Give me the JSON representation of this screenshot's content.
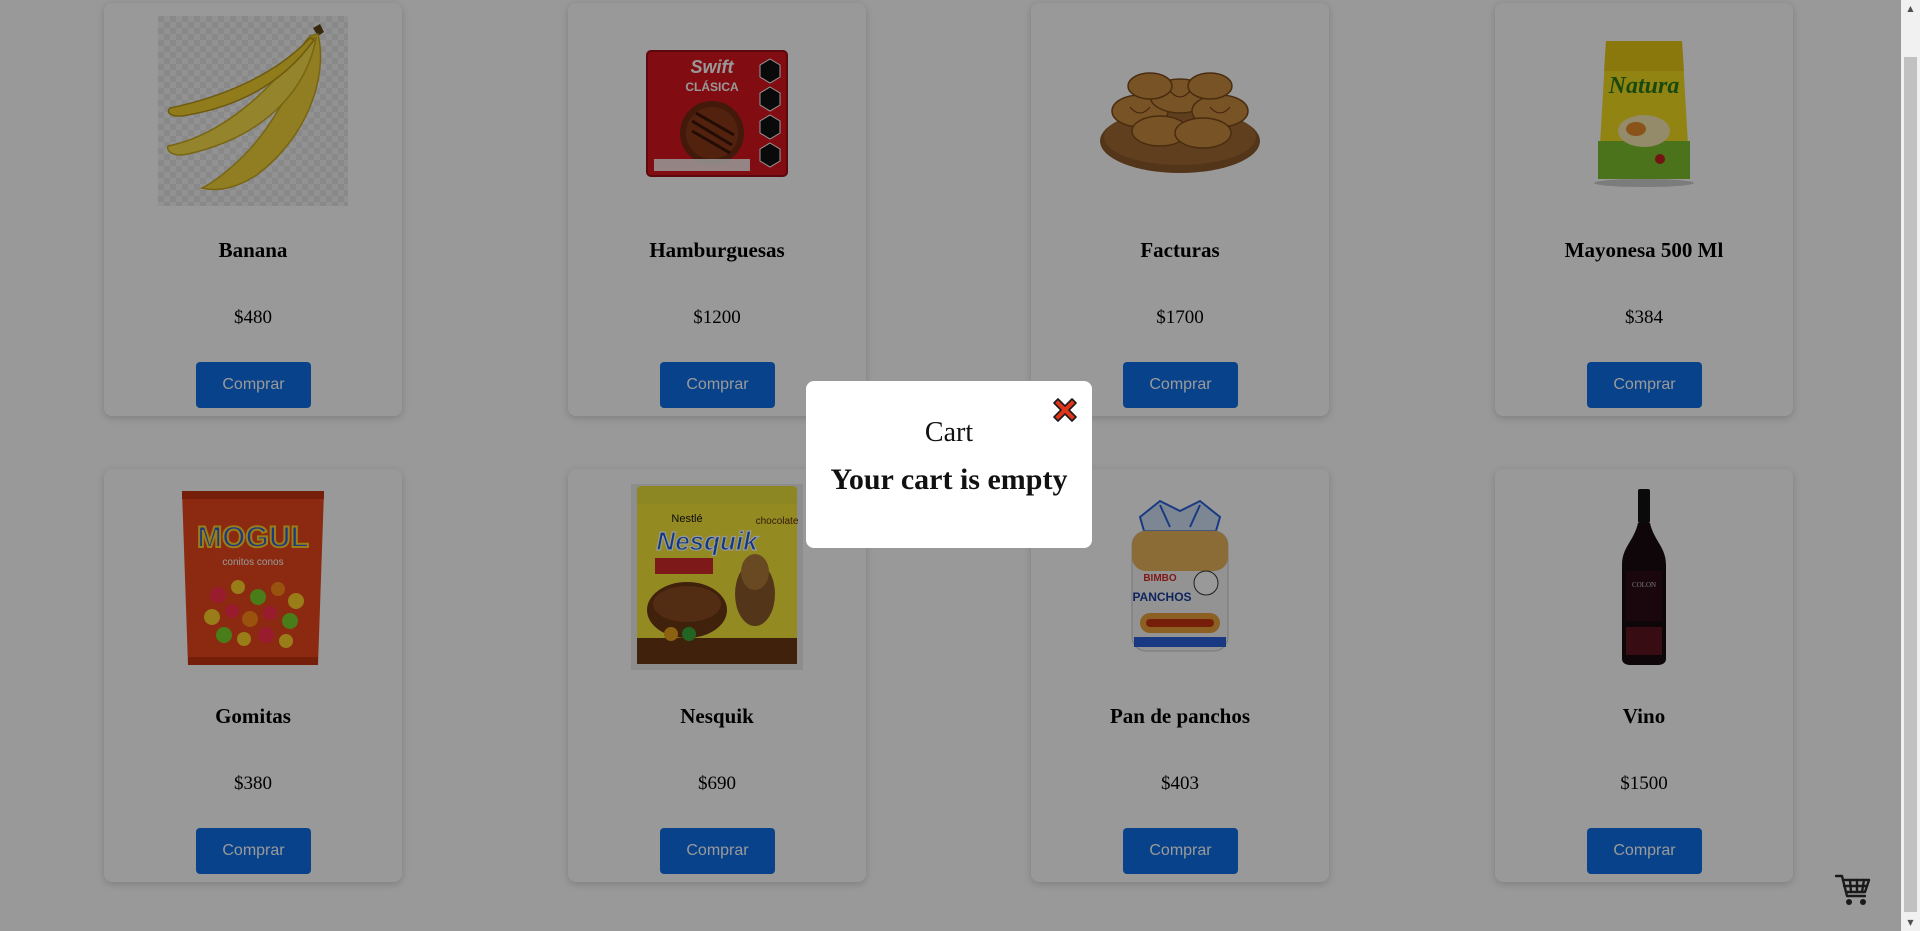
{
  "products": [
    {
      "name": "Banana",
      "price": "$480",
      "button": "Comprar",
      "icon": "banana-image"
    },
    {
      "name": "Hamburguesas",
      "price": "$1200",
      "button": "Comprar",
      "icon": "burger-box-image"
    },
    {
      "name": "Facturas",
      "price": "$1700",
      "button": "Comprar",
      "icon": "croissants-image"
    },
    {
      "name": "Mayonesa 500 Ml",
      "price": "$384",
      "button": "Comprar",
      "icon": "mayonnaise-pouch-image"
    },
    {
      "name": "Gomitas",
      "price": "$380",
      "button": "Comprar",
      "icon": "gummies-bag-image"
    },
    {
      "name": "Nesquik",
      "price": "$690",
      "button": "Comprar",
      "icon": "nesquik-can-image"
    },
    {
      "name": "Pan de panchos",
      "price": "$403",
      "button": "Comprar",
      "icon": "hotdog-buns-image"
    },
    {
      "name": "Vino",
      "price": "$1500",
      "button": "Comprar",
      "icon": "wine-bottle-image"
    }
  ],
  "modal": {
    "title": "Cart",
    "message": "Your cart is empty",
    "close_icon": "close-icon"
  },
  "cart_button": {
    "icon": "shopping-cart-icon"
  },
  "colors": {
    "button": "#0e6fe8",
    "overlay": "rgba(0,0,0,0.4)",
    "close": "#e0341b"
  }
}
